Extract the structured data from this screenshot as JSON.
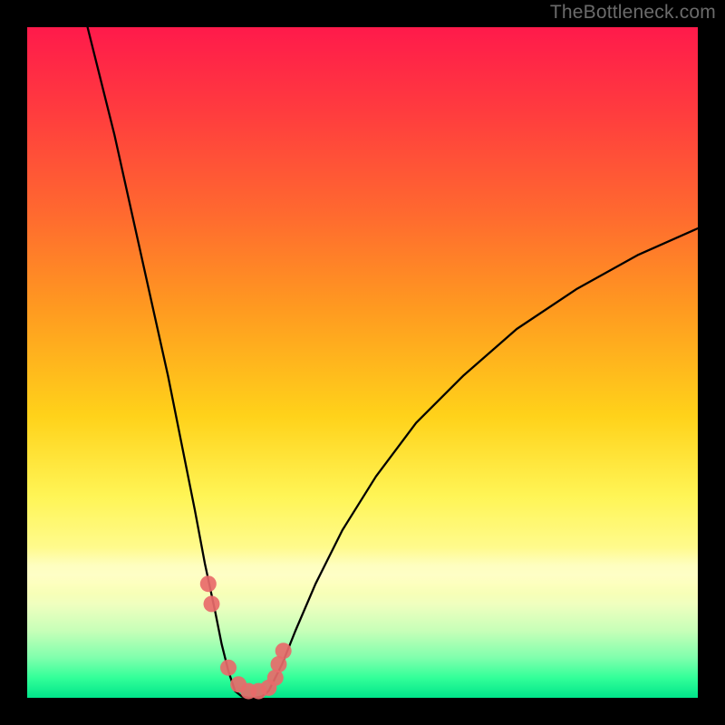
{
  "watermark": "TheBottleneck.com",
  "chart_data": {
    "type": "line",
    "title": "",
    "xlabel": "",
    "ylabel": "",
    "xlim": [
      0,
      100
    ],
    "ylim": [
      0,
      100
    ],
    "grid": false,
    "series": [
      {
        "name": "left-branch",
        "x": [
          9,
          11,
          13,
          15,
          17,
          19,
          21,
          23,
          25,
          26.5,
          28,
          29,
          30,
          31
        ],
        "y": [
          100,
          92,
          84,
          75,
          66,
          57,
          48,
          38,
          28,
          20,
          13,
          8,
          4,
          1
        ]
      },
      {
        "name": "valley",
        "x": [
          31,
          32,
          33,
          34,
          35,
          36
        ],
        "y": [
          1,
          0.2,
          0,
          0,
          0.2,
          1
        ]
      },
      {
        "name": "right-branch",
        "x": [
          36,
          38,
          40,
          43,
          47,
          52,
          58,
          65,
          73,
          82,
          91,
          100
        ],
        "y": [
          1,
          5,
          10,
          17,
          25,
          33,
          41,
          48,
          55,
          61,
          66,
          70
        ]
      },
      {
        "name": "marker-cluster",
        "x": [
          27,
          27.5,
          30,
          31.5,
          33,
          34.5,
          36,
          37,
          37.5,
          38.2
        ],
        "y": [
          17,
          14,
          4.5,
          2,
          1,
          1,
          1.5,
          3,
          5,
          7
        ]
      }
    ],
    "background_gradient": {
      "top": "#ff1a4b",
      "bottom": "#00e58a",
      "meaning": "red-high to green-low bottleneck gradient"
    },
    "marker_color": "#e86a6a",
    "line_color": "#000000"
  }
}
